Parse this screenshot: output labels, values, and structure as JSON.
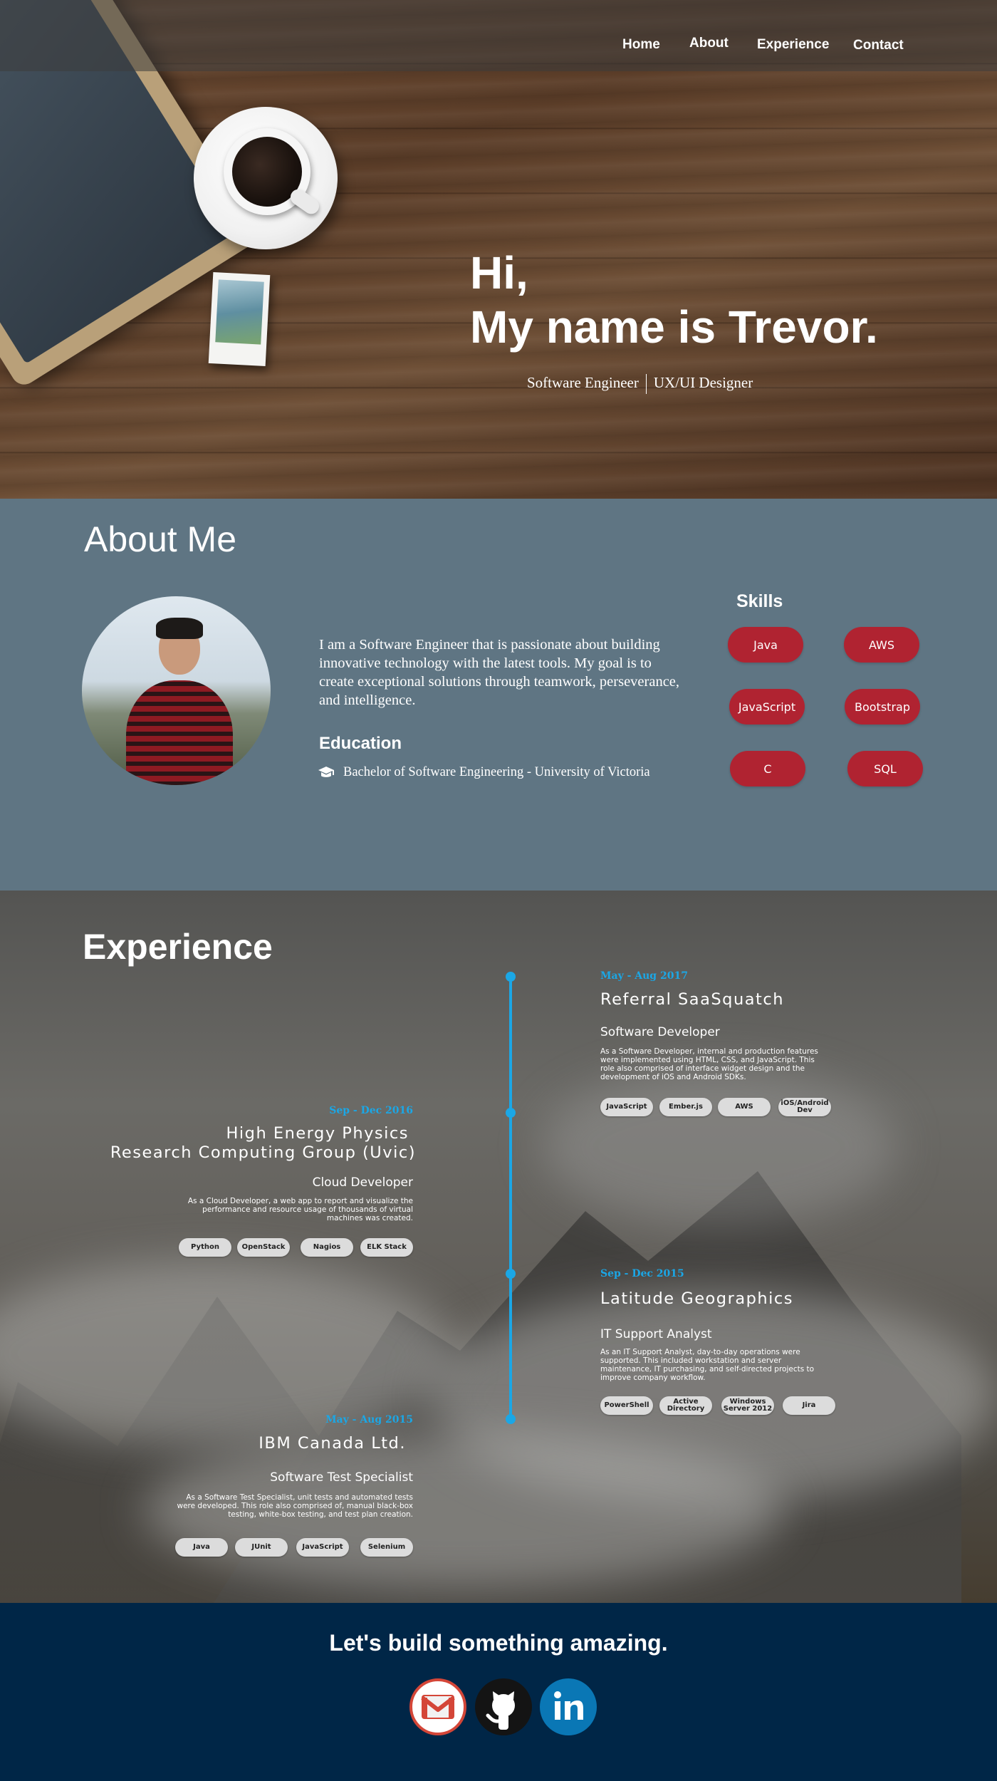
{
  "nav": {
    "items": [
      {
        "label": "Home"
      },
      {
        "label": "About"
      },
      {
        "label": "Experience"
      },
      {
        "label": "Contact"
      }
    ]
  },
  "hero": {
    "greeting": "Hi,",
    "name_line": "My name is Trevor.",
    "subtitle_left": "Software Engineer",
    "subtitle_right": "UX/UI Designer"
  },
  "about": {
    "title": "About Me",
    "bio": "I am a Software Engineer that is passionate about building innovative technology with the latest tools. My goal is to create exceptional solutions through teamwork, perseverance, and intelligence.",
    "education_title": "Education",
    "education_icon": "graduation-cap-icon",
    "education_text": "Bachelor of Software Engineering - University of Victoria",
    "skills_title": "Skills",
    "skills": [
      "Java",
      "AWS",
      "JavaScript",
      "Bootstrap",
      "C",
      "SQL"
    ],
    "skill_color": "#b02331"
  },
  "experience": {
    "title": "Experience",
    "accent_color": "#1ba7e6",
    "entries": [
      {
        "date": "May - Aug 2017",
        "company": "Referral SaaSquatch",
        "role": "Software Developer",
        "description": "As a Software Developer, internal and production features were implemented using HTML, CSS, and JavaScript. This role also comprised of interface widget design and the development of iOS and Android SDKs.",
        "tags": [
          "JavaScript",
          "Ember.js",
          "AWS",
          "iOS/Android Dev"
        ]
      },
      {
        "date": "Sep - Dec 2016",
        "company_line1": "High Energy Physics",
        "company_line2": "Research Computing Group (Uvic)",
        "role": "Cloud Developer",
        "description": "As a Cloud Developer, a web app to report and visualize the performance and resource usage of thousands of virtual machines was created.",
        "tags": [
          "Python",
          "OpenStack",
          "Nagios",
          "ELK Stack"
        ]
      },
      {
        "date": "Sep - Dec 2015",
        "company": "Latitude Geographics",
        "role": "IT Support Analyst",
        "description": "As an IT Support Analyst, day-to-day operations were supported. This included workstation and server maintenance, IT purchasing, and self-directed projects to improve company workflow.",
        "tags": [
          "PowerShell",
          "Active Directory",
          "Windows Server 2012",
          "Jira"
        ]
      },
      {
        "date": "May - Aug 2015",
        "company": "IBM Canada Ltd.",
        "role": "Software Test Specialist",
        "description": "As a Software Test Specialist, unit tests and automated tests were developed. This role also comprised of, manual black-box testing, white-box testing, and test plan creation.",
        "tags": [
          "Java",
          "JUnit",
          "JavaScript",
          "Selenium"
        ]
      }
    ]
  },
  "footer": {
    "tagline": "Let's build something amazing.",
    "social_icons": [
      "gmail-icon",
      "github-icon",
      "linkedin-icon"
    ],
    "colors": {
      "background": "#002647",
      "linkedin": "#0a77b5",
      "gmail_red": "#d44638"
    }
  }
}
